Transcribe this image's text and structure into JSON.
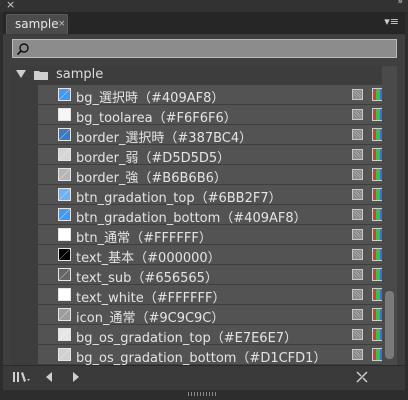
{
  "window": {
    "close_glyph": "×",
    "collapse_glyph": "»"
  },
  "tab": {
    "label": "sample",
    "close_glyph": "×"
  },
  "panel_menu_glyph": "▾≡",
  "search": {
    "placeholder": "",
    "icon": "search-icon"
  },
  "folder": {
    "label": "sample",
    "expanded": true
  },
  "items": [
    {
      "label": "bg_選択時（#409AF8）",
      "color": "#409AF8"
    },
    {
      "label": "bg_toolarea（#F6F6F6）",
      "color": "#F6F6F6"
    },
    {
      "label": "border_選択時（#387BC4）",
      "color": "#387BC4"
    },
    {
      "label": "border_弱（#D5D5D5）",
      "color": "#D5D5D5"
    },
    {
      "label": "border_強（#B6B6B6）",
      "color": "#B6B6B6"
    },
    {
      "label": "btn_gradation_top（#6BB2F7）",
      "color": "#6BB2F7"
    },
    {
      "label": "btn_gradation_bottom（#409AF8）",
      "color": "#409AF8"
    },
    {
      "label": "btn_通常（#FFFFFF）",
      "color": "#FFFFFF"
    },
    {
      "label": "text_基本（#000000）",
      "color": "#000000"
    },
    {
      "label": "text_sub（#656565）",
      "color": "#656565"
    },
    {
      "label": "text_white（#FFFFFF）",
      "color": "#FFFFFF"
    },
    {
      "label": "icon_通常（#9C9C9C）",
      "color": "#9C9C9C"
    },
    {
      "label": "bg_os_gradation_top（#E7E6E7）",
      "color": "#E7E6E7"
    },
    {
      "label": "bg_os_gradation_bottom（#D1CFD1）",
      "color": "#D1CFD1"
    }
  ],
  "footer": {
    "icons": [
      "swatch-libraries-icon",
      "previous-icon",
      "next-icon",
      "swatch-options-icon"
    ]
  }
}
